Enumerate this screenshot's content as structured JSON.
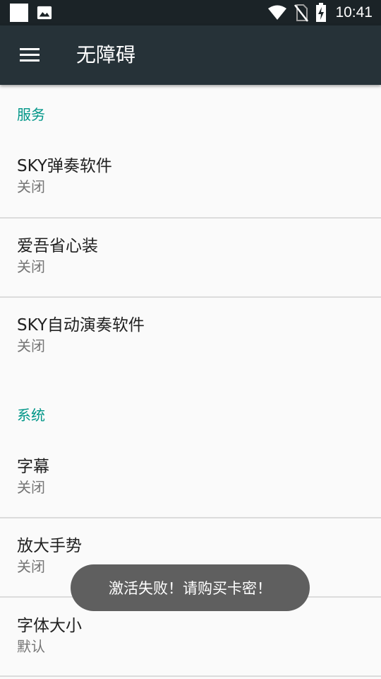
{
  "status_bar": {
    "time": "10:41",
    "icons": [
      "notification-square-icon",
      "image-icon",
      "wifi-icon",
      "no-sim-icon",
      "battery-charging-icon"
    ]
  },
  "app_bar": {
    "title": "无障碍",
    "menu_icon": "menu-icon"
  },
  "sections": [
    {
      "header": "服务",
      "items": [
        {
          "title": "SKY弹奏软件",
          "summary": "关闭"
        },
        {
          "title": "爱吾省心装",
          "summary": "关闭"
        },
        {
          "title": "SKY自动演奏软件",
          "summary": "关闭"
        }
      ]
    },
    {
      "header": "系统",
      "items": [
        {
          "title": "字幕",
          "summary": "关闭"
        },
        {
          "title": "放大手势",
          "summary": "关闭"
        },
        {
          "title": "字体大小",
          "summary": "默认"
        }
      ]
    }
  ],
  "toast": {
    "message": "激活失败！请购买卡密！"
  },
  "colors": {
    "status_bar": "#1b2327",
    "app_bar": "#263238",
    "accent": "#009688",
    "background": "#fafafa",
    "divider": "#dcdcdc",
    "toast": "#5f5f5f"
  }
}
